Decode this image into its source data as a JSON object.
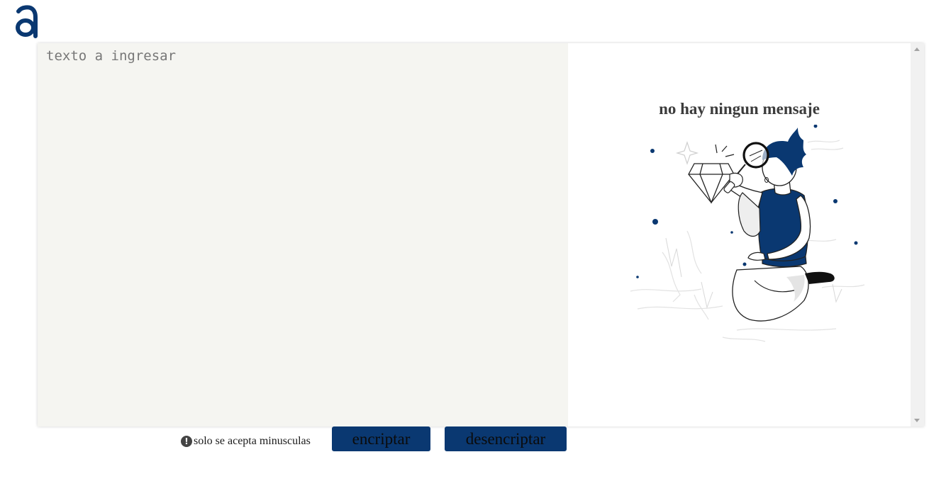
{
  "logo": {
    "icon": "alura-a-logo-icon",
    "color": "#0a3871"
  },
  "input": {
    "placeholder": "texto a ingresar",
    "value": ""
  },
  "output": {
    "title": "no hay ningun mensaje",
    "illustration": "person-with-magnifying-glass-and-diamond"
  },
  "footer": {
    "warning_icon": "exclamation-circle-icon",
    "warning_text": "solo se acepta minusculas",
    "encrypt_label": "encriptar",
    "decrypt_label": "desencriptar"
  },
  "colors": {
    "accent": "#0a3871",
    "input_bg": "#f5f5f1",
    "output_bg": "#ffffff",
    "title_text": "#3c3c3c"
  }
}
